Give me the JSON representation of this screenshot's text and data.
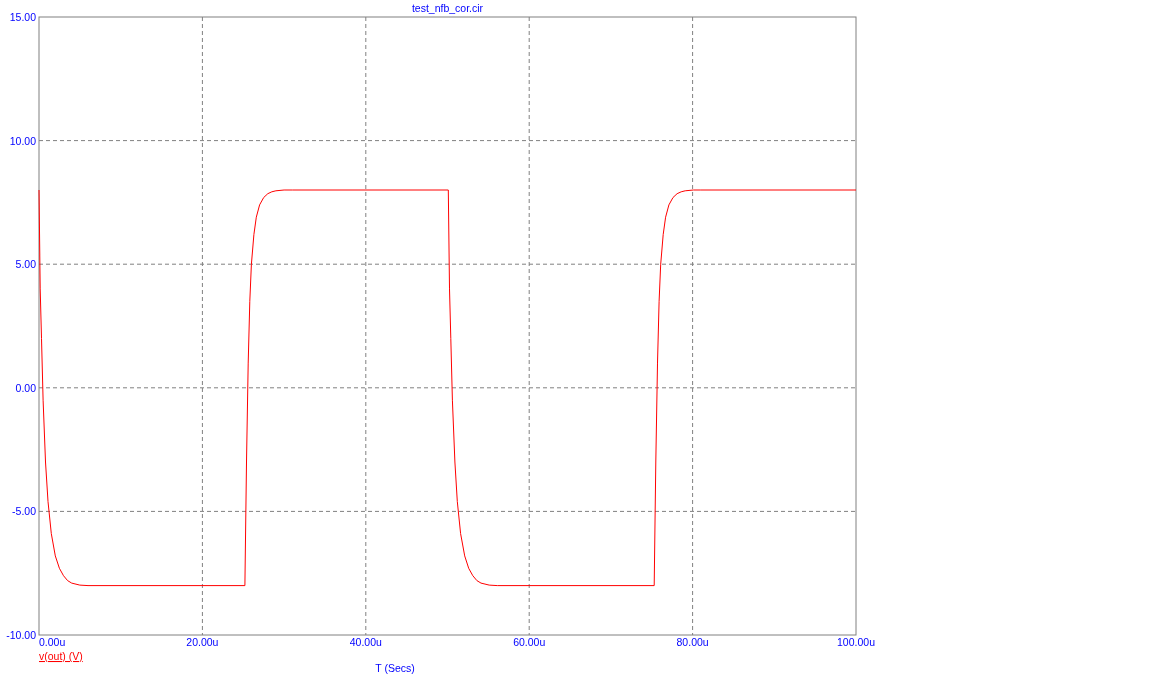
{
  "plot": {
    "chart_data": {
      "type": "line",
      "grid": true,
      "title": "test_nfb_cor.cir",
      "xlabel": "T (Secs)",
      "xlim": [
        0,
        100
      ],
      "ylim": [
        -10,
        15
      ],
      "xticks": [
        {
          "value": 0,
          "label": "0.00u"
        },
        {
          "value": 20,
          "label": "20.00u"
        },
        {
          "value": 40,
          "label": "40.00u"
        },
        {
          "value": 60,
          "label": "60.00u"
        },
        {
          "value": 80,
          "label": "80.00u"
        },
        {
          "value": 100,
          "label": "100.00u"
        }
      ],
      "yticks": [
        {
          "value": -10,
          "label": "-10.00"
        },
        {
          "value": -5,
          "label": "-5.00"
        },
        {
          "value": 0,
          "label": "0.00"
        },
        {
          "value": 5,
          "label": "5.00"
        },
        {
          "value": 10,
          "label": "10.00"
        },
        {
          "value": 15,
          "label": "15.00"
        }
      ],
      "x": [
        0,
        0.15,
        0.3,
        0.5,
        0.8,
        1.1,
        1.5,
        2,
        2.5,
        3,
        3.5,
        4,
        5,
        6,
        25.2,
        25.4,
        25.6,
        25.8,
        26,
        26.3,
        26.6,
        27,
        27.5,
        28,
        28.5,
        29,
        30,
        31,
        50.1,
        50.25,
        50.4,
        50.6,
        50.9,
        51.2,
        51.6,
        52.1,
        52.6,
        53.1,
        53.6,
        54.1,
        55.1,
        56.1,
        75.3,
        75.5,
        75.7,
        75.9,
        76.1,
        76.4,
        76.7,
        77.1,
        77.6,
        78.1,
        78.6,
        79.1,
        80.1,
        81,
        100
      ],
      "series": [
        {
          "name": "v(out) (V)",
          "color": "#ff0000",
          "values": [
            8,
            4,
            2,
            -0.5,
            -3,
            -4.6,
            -5.9,
            -6.8,
            -7.3,
            -7.6,
            -7.8,
            -7.9,
            -7.98,
            -8,
            -8,
            -3,
            1,
            3.5,
            5,
            6.2,
            6.9,
            7.4,
            7.7,
            7.85,
            7.93,
            7.97,
            8,
            8,
            8,
            4,
            2,
            -0.5,
            -3,
            -4.6,
            -5.9,
            -6.8,
            -7.3,
            -7.6,
            -7.8,
            -7.9,
            -7.98,
            -8,
            -8,
            -3,
            1,
            3.5,
            5,
            6.2,
            6.9,
            7.4,
            7.7,
            7.85,
            7.93,
            7.97,
            8,
            8,
            8
          ]
        }
      ]
    }
  }
}
